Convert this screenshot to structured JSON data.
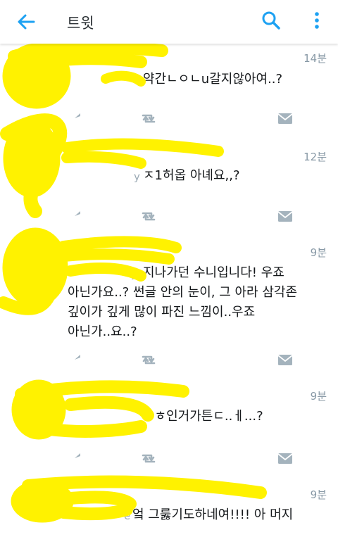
{
  "appbar": {
    "title": "트윗",
    "icons": [
      "back-arrow-icon",
      "search-icon",
      "more-vertical-icon"
    ]
  },
  "colors": {
    "accent": "#1da1f2",
    "action_icon": "#a4b3bd",
    "redaction": "#fff200"
  },
  "tweets": [
    {
      "time": "14분",
      "handle": "",
      "lines": [
        "약간ㄴㅇㄴu갈지않아여..?"
      ]
    },
    {
      "time": "12분",
      "handle": "y",
      "lines": [
        "ㅈ1허옵 아녜요,,?"
      ]
    },
    {
      "time": "9분",
      "handle": "y",
      "lines": [
        "지나가던 수니입니다! 우죠",
        "아닌가요..? 썬글 안의 눈이, 그 아라 삼각존",
        "깊이가 깊게 많이 파진 느낌이..우죠",
        "아닌가..요..?"
      ]
    },
    {
      "time": "9분",
      "handle": "",
      "lines": [
        "ㅈㅎ인거가튼ㄷ..ㅔ...?"
      ]
    },
    {
      "time": "9분",
      "handle": "e",
      "lines": [
        "엌 그룷기도하네여!!!! 아 머지"
      ]
    }
  ]
}
